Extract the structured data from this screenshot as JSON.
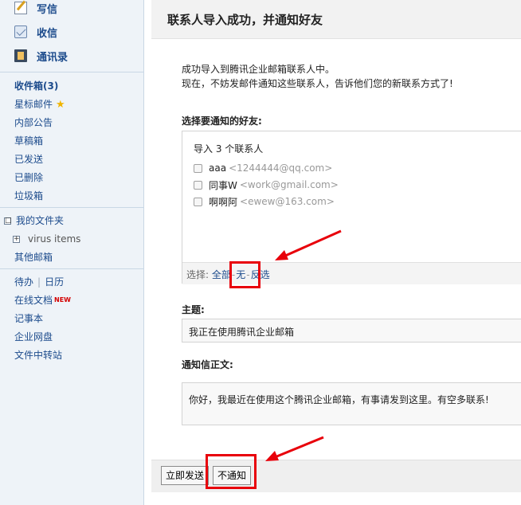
{
  "sidebar": {
    "primary": [
      {
        "label": "写信",
        "icon": "compose-pencil-icon"
      },
      {
        "label": "收信",
        "icon": "inbox-icon"
      },
      {
        "label": "通讯录",
        "icon": "address-book-icon"
      }
    ],
    "folders": [
      {
        "label": "收件箱(3)"
      },
      {
        "label": "星标邮件",
        "icon": "star-icon",
        "icon_glyph": "★"
      },
      {
        "label": "内部公告"
      },
      {
        "label": "草稿箱"
      },
      {
        "label": "已发送"
      },
      {
        "label": "已删除"
      },
      {
        "label": "垃圾箱"
      }
    ],
    "my_folders": {
      "toggle": "□",
      "label": "我的文件夹",
      "child": {
        "toggle": "+",
        "label": "virus items"
      }
    },
    "other_mail": "其他邮箱",
    "tools": {
      "todo": "待办",
      "separator": "|",
      "calendar": "日历",
      "online_docs": "在线文档",
      "new_badge": "NEW",
      "notebook": "记事本",
      "disk": "企业网盘",
      "transfer": "文件中转站"
    }
  },
  "main": {
    "title": "联系人导入成功，并通知好友",
    "message_line1": "成功导入到腾讯企业邮箱联系人中。",
    "message_line2": "现在，不妨发邮件通知这些联系人，告诉他们您的新联系方式了!",
    "choose_label": "选择要通知的好友:",
    "import_count": "导入 3 个联系人",
    "contacts": [
      {
        "name": "aaa",
        "email": "<1244444@qq.com>"
      },
      {
        "name": "同事W",
        "email": "<work@gmail.com>"
      },
      {
        "name": "啊啊阿",
        "email": "<ewew@163.com>"
      }
    ],
    "select_bar": {
      "label": "选择:",
      "all": "全部",
      "none": "无",
      "invert": "反选",
      "dot": "-"
    },
    "subject_label": "主题:",
    "subject_value": "我正在使用腾讯企业邮箱",
    "body_label": "通知信正文:",
    "body_value": "你好，我最近在使用这个腾讯企业邮箱，有事请发到这里。有空多联系!",
    "buttons": {
      "send": "立即发送",
      "no_notify": "不通知"
    }
  },
  "colors": {
    "link": "#1c4b8c",
    "annotation_red": "#e8000a",
    "sidebar_bg": "#eef3f8"
  }
}
